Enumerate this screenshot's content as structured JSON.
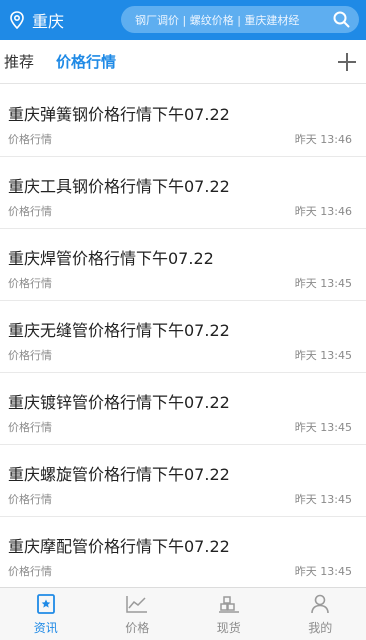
{
  "header": {
    "city": "重庆",
    "search_placeholder": "钢厂调价 | 螺纹价格 | 重庆建材经"
  },
  "tabs": [
    {
      "label": "推荐",
      "active": false
    },
    {
      "label": "价格行情",
      "active": true
    }
  ],
  "items": [
    {
      "title": "重庆弹簧钢价格行情下午07.22",
      "tag": "价格行情",
      "time": "昨天 13:46"
    },
    {
      "title": "重庆工具钢价格行情下午07.22",
      "tag": "价格行情",
      "time": "昨天 13:46"
    },
    {
      "title": "重庆焊管价格行情下午07.22",
      "tag": "价格行情",
      "time": "昨天 13:45"
    },
    {
      "title": "重庆无缝管价格行情下午07.22",
      "tag": "价格行情",
      "time": "昨天 13:45"
    },
    {
      "title": "重庆镀锌管价格行情下午07.22",
      "tag": "价格行情",
      "time": "昨天 13:45"
    },
    {
      "title": "重庆螺旋管价格行情下午07.22",
      "tag": "价格行情",
      "time": "昨天 13:45"
    },
    {
      "title": "重庆摩配管价格行情下午07.22",
      "tag": "价格行情",
      "time": "昨天 13:45"
    }
  ],
  "bottom_nav": [
    {
      "label": "资讯",
      "icon": "news-icon",
      "active": true
    },
    {
      "label": "价格",
      "icon": "chart-icon",
      "active": false
    },
    {
      "label": "现货",
      "icon": "warehouse-icon",
      "active": false
    },
    {
      "label": "我的",
      "icon": "user-icon",
      "active": false
    }
  ],
  "colors": {
    "primary": "#1f8ae6",
    "search_bg": "#5eaef0",
    "text_secondary": "#8a8a8a"
  }
}
